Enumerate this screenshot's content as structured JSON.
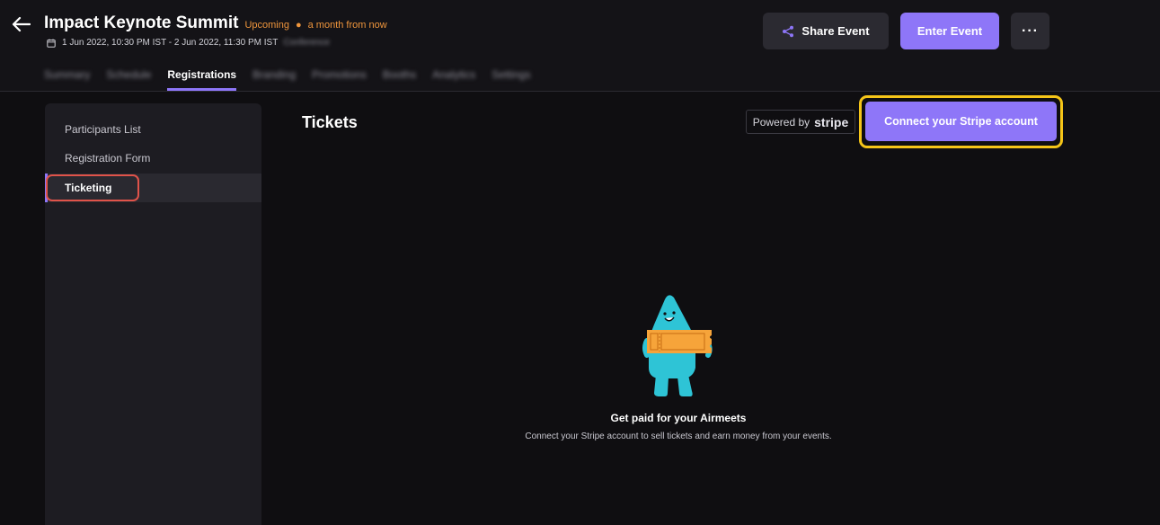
{
  "header": {
    "title": "Impact Keynote Summit",
    "status": "Upcoming",
    "status_when": "a month from now",
    "date_range": "1 Jun 2022, 10:30 PM IST - 2 Jun 2022, 11:30 PM IST",
    "event_type_blurred": "Conference",
    "share_label": "Share Event",
    "enter_label": "Enter Event",
    "more_label": "···"
  },
  "tabs": [
    {
      "label": "Summary"
    },
    {
      "label": "Schedule"
    },
    {
      "label": "Registrations"
    },
    {
      "label": "Branding"
    },
    {
      "label": "Promotions"
    },
    {
      "label": "Booths"
    },
    {
      "label": "Analytics"
    },
    {
      "label": "Settings"
    }
  ],
  "sidebar": {
    "items": [
      {
        "label": "Participants List"
      },
      {
        "label": "Registration Form"
      },
      {
        "label": "Ticketing"
      }
    ]
  },
  "main": {
    "title": "Tickets",
    "powered_by": "Powered by",
    "powered_brand": "stripe",
    "connect_label": "Connect your Stripe account",
    "empty_title": "Get paid for your Airmeets",
    "empty_desc": "Connect your Stripe account to sell tickets and earn money from your events."
  },
  "colors": {
    "accent": "#8e76f8",
    "status": "#f0963c",
    "highlight_yellow": "#f5c518",
    "highlight_red": "#e0534a",
    "mascot": "#2ec4d6",
    "ticket": "#f6a43a"
  }
}
